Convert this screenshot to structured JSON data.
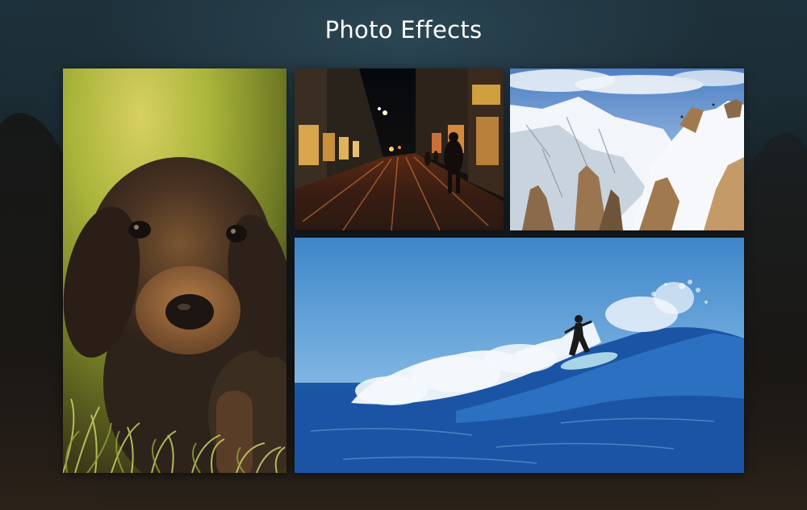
{
  "header": {
    "title": "Photo Effects"
  },
  "photos": [
    {
      "icon": "puppy-photo-icon"
    },
    {
      "icon": "night-street-photo-icon"
    },
    {
      "icon": "snowy-mountain-photo-icon"
    },
    {
      "icon": "surfer-wave-photo-icon"
    }
  ],
  "colors": {
    "title_text": "#ffffff",
    "background": "#151d21"
  }
}
